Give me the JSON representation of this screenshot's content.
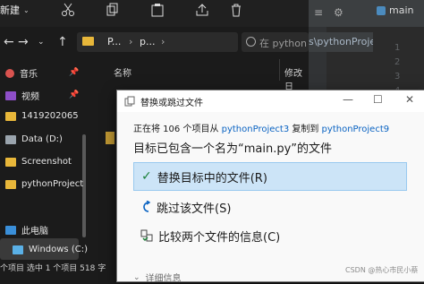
{
  "explorer": {
    "new_label": "新建",
    "address_seg1": "P...",
    "address_seg2": "p...",
    "search_placeholder": "在 python",
    "col_name": "名称",
    "col_modified": "修改日",
    "sidebar": [
      {
        "label": "音乐",
        "icon": "music-icon",
        "pinned": true
      },
      {
        "label": "视频",
        "icon": "video-icon",
        "pinned": true
      },
      {
        "label": "1419202065",
        "icon": "folder-icon",
        "pinned": false
      },
      {
        "label": "Data (D:)",
        "icon": "drive-icon",
        "pinned": false
      },
      {
        "label": "Screenshot",
        "icon": "folder-icon",
        "pinned": false
      },
      {
        "label": "pythonProject",
        "icon": "folder-icon",
        "pinned": false
      },
      {
        "label": "此电脑",
        "icon": "pc-icon",
        "pinned": false
      },
      {
        "label": "Windows (C:)",
        "icon": "drive-icon",
        "pinned": false
      }
    ],
    "status": "个项目   选中 1 个项目  518 字"
  },
  "editor": {
    "tab_label": "main",
    "breadcrumb": "s\\pythonProject",
    "line_numbers": [
      "1",
      "2",
      "3",
      "4",
      "5",
      "6",
      "7"
    ]
  },
  "dialog": {
    "title": "替换或跳过文件",
    "line1_prefix": "正在将 106 个项目从 ",
    "source": "pythonProject3",
    "line1_mid": " 复制到 ",
    "dest": "pythonProject9",
    "line2": "目标已包含一个名为“main.py”的文件",
    "options": [
      {
        "label": "替换目标中的文件(R)",
        "icon": "checkmark-icon",
        "selected": true
      },
      {
        "label": "跳过该文件(S)",
        "icon": "skip-icon",
        "selected": false
      },
      {
        "label": "比较两个文件的信息(C)",
        "icon": "compare-icon",
        "selected": false
      }
    ],
    "details_label": "详细信息"
  },
  "watermark": "CSDN @热心市民小蔡"
}
